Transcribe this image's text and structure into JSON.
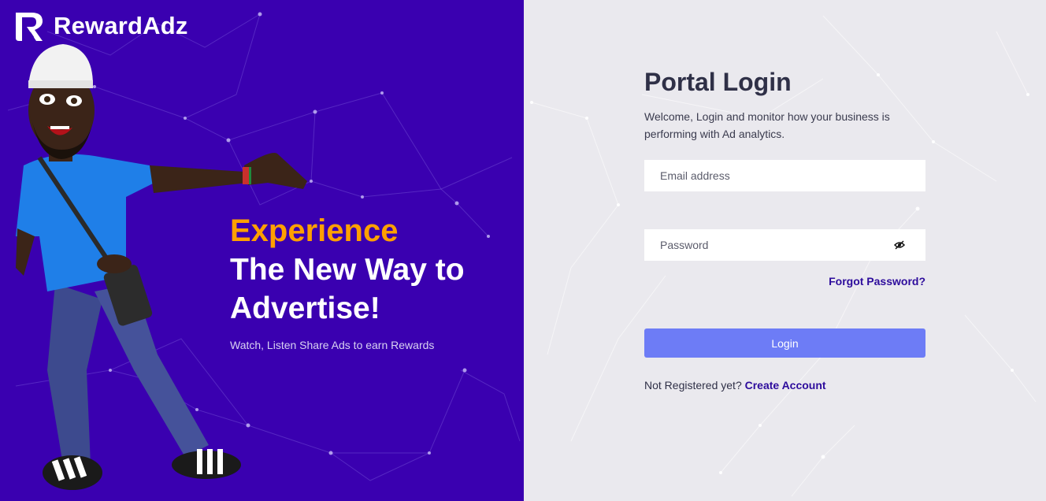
{
  "brand": {
    "name": "RewardAdz"
  },
  "hero": {
    "accent": "Experience",
    "line1": "The New Way to",
    "line2": "Advertise!",
    "subtitle": "Watch, Listen Share Ads to earn Rewards"
  },
  "login": {
    "title": "Portal Login",
    "description": "Welcome, Login and monitor how your business is performing with Ad analytics.",
    "email_placeholder": "Email address",
    "password_placeholder": "Password",
    "forgot_label": "Forgot Password?",
    "login_label": "Login",
    "register_prompt": "Not Registered yet?",
    "register_link": "Create Account"
  },
  "icons": {
    "logo": "rewardadz-logo-icon",
    "password_toggle": "eye-hidden-icon"
  },
  "colors": {
    "left_bg": "#3a00b0",
    "right_bg": "#eae9ee",
    "accent": "#ffa000",
    "link": "#2d0c9c",
    "button": "#6d7cf6"
  }
}
